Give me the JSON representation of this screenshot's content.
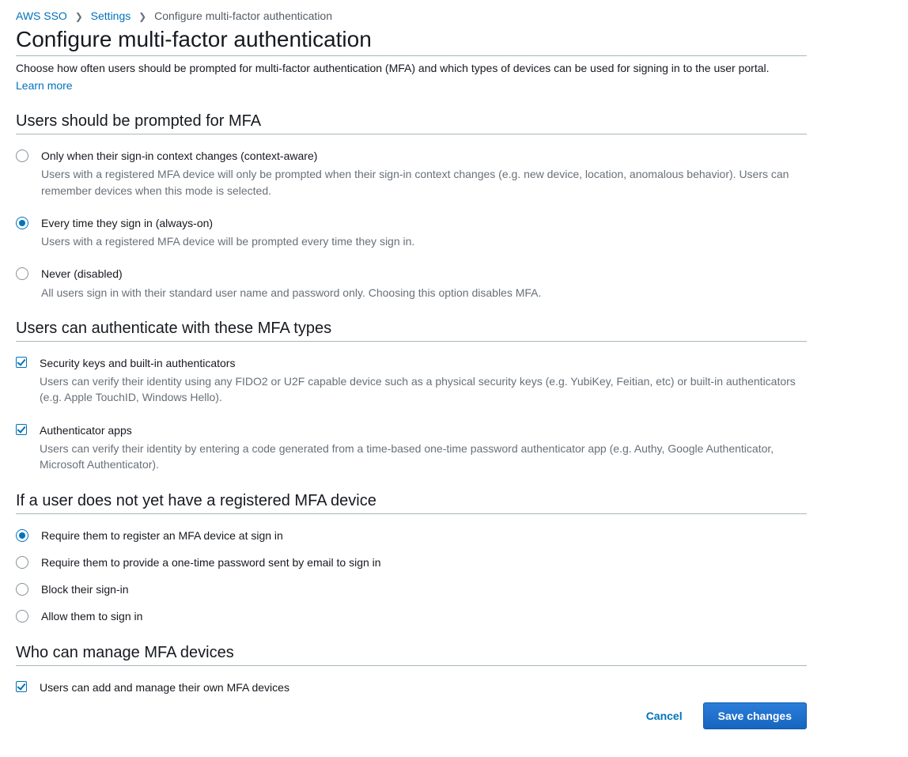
{
  "breadcrumb": {
    "aws_sso": "AWS SSO",
    "settings": "Settings",
    "current": "Configure multi-factor authentication"
  },
  "page": {
    "title": "Configure multi-factor authentication",
    "description": "Choose how often users should be prompted for multi-factor authentication (MFA) and which types of devices can be used for signing in to the user portal.",
    "learn_more": "Learn more"
  },
  "sections": {
    "prompt": {
      "title": "Users should be prompted for MFA",
      "options": [
        {
          "label": "Only when their sign-in context changes (context-aware)",
          "desc": "Users with a registered MFA device will only be prompted when their sign-in context changes (e.g. new device, location, anomalous behavior). Users can remember devices when this mode is selected.",
          "selected": false
        },
        {
          "label": "Every time they sign in (always-on)",
          "desc": "Users with a registered MFA device will be prompted every time they sign in.",
          "selected": true
        },
        {
          "label": "Never (disabled)",
          "desc": "All users sign in with their standard user name and password only. Choosing this option disables MFA.",
          "selected": false
        }
      ]
    },
    "types": {
      "title": "Users can authenticate with these MFA types",
      "options": [
        {
          "label": "Security keys and built-in authenticators",
          "desc": "Users can verify their identity using any FIDO2 or U2F capable device such as a physical security keys (e.g. YubiKey, Feitian, etc) or built-in authenticators (e.g. Apple TouchID, Windows Hello).",
          "checked": true
        },
        {
          "label": "Authenticator apps",
          "desc": "Users can verify their identity by entering a code generated from a time-based one-time password authenticator app (e.g. Authy, Google Authenticator, Microsoft Authenticator).",
          "checked": true
        }
      ]
    },
    "no_device": {
      "title": "If a user does not yet have a registered MFA device",
      "options": [
        {
          "label": "Require them to register an MFA device at sign in",
          "selected": true
        },
        {
          "label": "Require them to provide a one-time password sent by email to sign in",
          "selected": false
        },
        {
          "label": "Block their sign-in",
          "selected": false
        },
        {
          "label": "Allow them to sign in",
          "selected": false
        }
      ]
    },
    "manage": {
      "title": "Who can manage MFA devices",
      "options": [
        {
          "label": "Users can add and manage their own MFA devices",
          "checked": true
        }
      ]
    }
  },
  "footer": {
    "cancel": "Cancel",
    "save": "Save changes"
  }
}
